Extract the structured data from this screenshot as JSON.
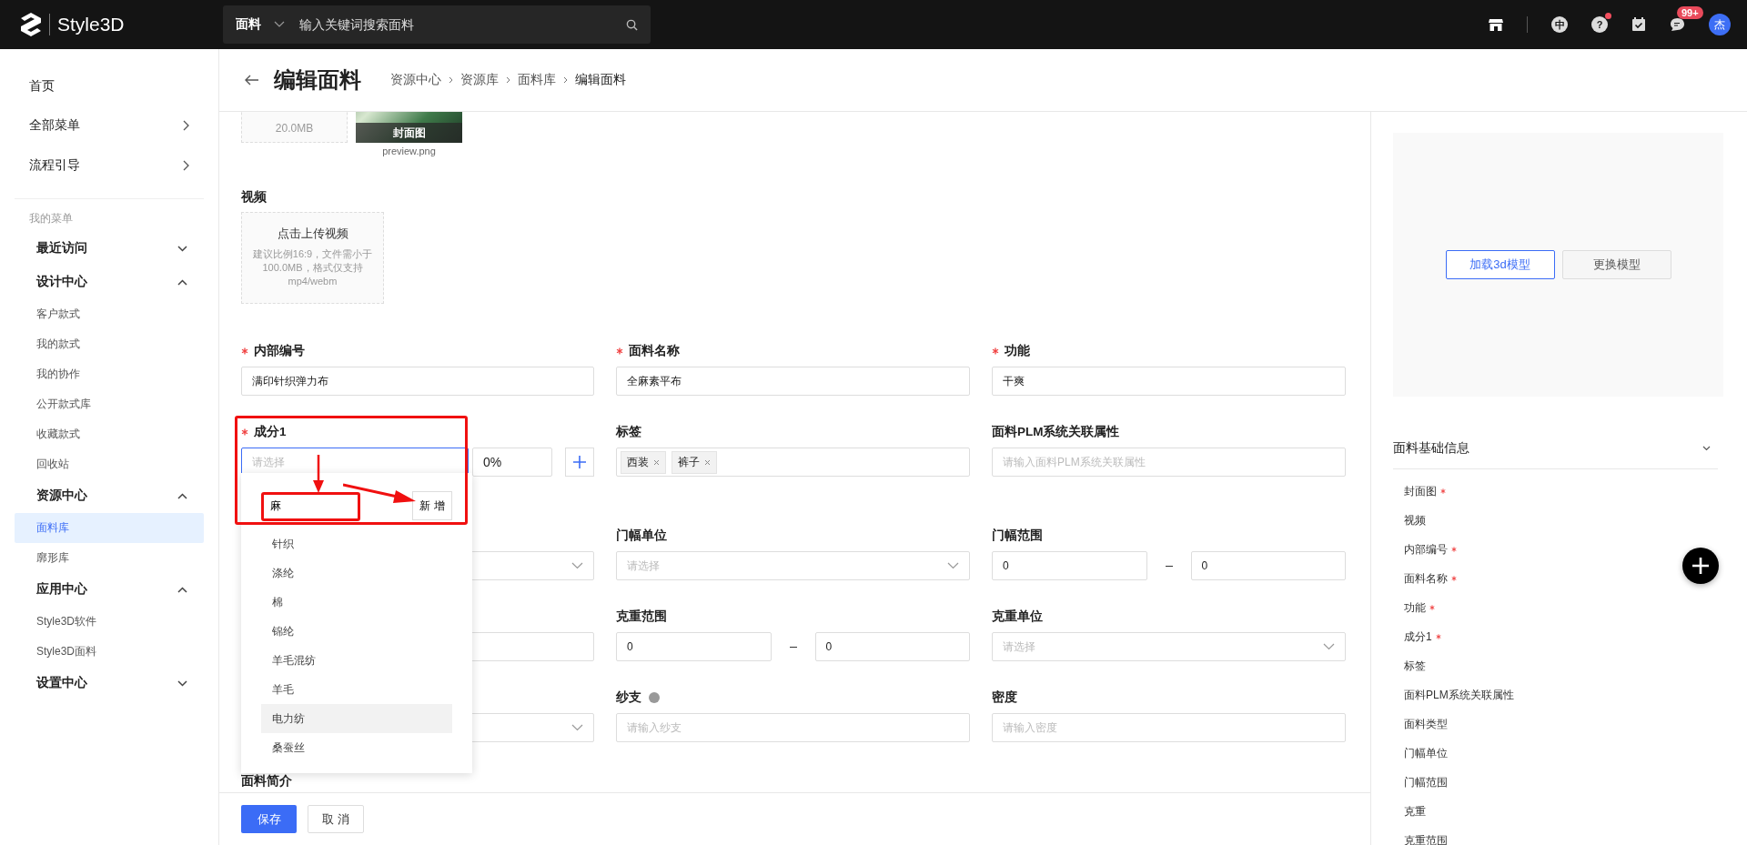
{
  "header": {
    "logo": "Style3D",
    "search": {
      "category": "面料",
      "placeholder": "输入关键词搜索面料"
    },
    "language": "中",
    "help": "?",
    "help_dot": true,
    "message_badge": "99+",
    "avatar": "杰"
  },
  "sidebar": {
    "top_items": [
      {
        "label": "首页",
        "has_arrow": false
      },
      {
        "label": "全部菜单",
        "has_arrow": true
      },
      {
        "label": "流程引导",
        "has_arrow": true
      }
    ],
    "section_title": "我的菜单",
    "groups": [
      {
        "label": "最近访问",
        "expanded": false
      },
      {
        "label": "设计中心",
        "expanded": true,
        "children": [
          {
            "label": "客户款式",
            "selected": false
          },
          {
            "label": "我的款式",
            "selected": false
          },
          {
            "label": "我的协作",
            "selected": false
          },
          {
            "label": "公开款式库",
            "selected": false
          },
          {
            "label": "收藏款式",
            "selected": false
          },
          {
            "label": "回收站",
            "selected": false
          }
        ]
      },
      {
        "label": "资源中心",
        "expanded": true,
        "children": [
          {
            "label": "面料库",
            "selected": true
          },
          {
            "label": "廓形库",
            "selected": false
          }
        ]
      },
      {
        "label": "应用中心",
        "expanded": true,
        "children": [
          {
            "label": "Style3D软件",
            "selected": false
          },
          {
            "label": "Style3D面料",
            "selected": false
          }
        ]
      },
      {
        "label": "设置中心",
        "expanded": false
      }
    ]
  },
  "page": {
    "title": "编辑面料",
    "breadcrumb": [
      "资源中心",
      "资源库",
      "面料库",
      "编辑面料"
    ]
  },
  "uploads": {
    "cover_hint": "20.0MB",
    "cover_overlay": "封面图",
    "cover_filename": "preview.png",
    "video_label": "视频",
    "video_title": "点击上传视频",
    "video_hint": "建议比例16:9，文件需小于100.0MB，格式仅支持mp4/webm"
  },
  "rows": [
    [
      {
        "kind": "input",
        "label": "内部编号",
        "required": true,
        "value": "满印针织弹力布"
      },
      {
        "kind": "input",
        "label": "面料名称",
        "required": true,
        "value": "全麻素平布"
      },
      {
        "kind": "input",
        "label": "功能",
        "required": true,
        "value": "干爽"
      }
    ],
    [
      {
        "kind": "composition",
        "label": "成分1",
        "required": true,
        "placeholder": "请选择",
        "percent": "0%",
        "focused": true
      },
      {
        "kind": "tags",
        "label": "标签",
        "required": false,
        "tags": [
          "西装",
          "裤子"
        ]
      },
      {
        "kind": "input",
        "label": "面料PLM系统关联属性",
        "required": false,
        "placeholder": "请输入面料PLM系统关联属性"
      }
    ],
    [
      {
        "kind": "select"
      },
      {
        "kind": "select",
        "label": "门幅单位",
        "required": false,
        "placeholder": "请选择"
      },
      {
        "kind": "range",
        "label": "门幅范围",
        "required": false,
        "from": "0",
        "to": "0"
      }
    ],
    [
      {
        "kind": "input"
      },
      {
        "kind": "range",
        "label": "克重范围",
        "required": false,
        "from": "0",
        "to": "0"
      },
      {
        "kind": "select",
        "label": "克重单位",
        "required": false,
        "placeholder": "请选择"
      }
    ],
    [
      {
        "kind": "select"
      },
      {
        "kind": "input",
        "label": "纱支",
        "required": false,
        "info": true,
        "placeholder": "请输入纱支"
      },
      {
        "kind": "input",
        "label": "密度",
        "required": false,
        "placeholder": "请输入密度"
      }
    ]
  ],
  "intro_label": "面料简介",
  "dropdown": {
    "search_value": "麻",
    "add_button": "新 增",
    "options": [
      {
        "label": "针织",
        "highlighted": false
      },
      {
        "label": "涤纶",
        "highlighted": false
      },
      {
        "label": "棉",
        "highlighted": false
      },
      {
        "label": "锦纶",
        "highlighted": false
      },
      {
        "label": "羊毛混纺",
        "highlighted": false
      },
      {
        "label": "羊毛",
        "highlighted": false
      },
      {
        "label": "电力纺",
        "highlighted": true
      },
      {
        "label": "桑蚕丝",
        "highlighted": false
      }
    ]
  },
  "footer": {
    "save": "保存",
    "cancel": "取 消"
  },
  "right_panel": {
    "load_button": "加载3d模型",
    "replace_button": "更换模型",
    "section_title": "面料基础信息",
    "anchors": [
      {
        "label": "封面图",
        "required": true
      },
      {
        "label": "视频",
        "required": false
      },
      {
        "label": "内部编号",
        "required": true
      },
      {
        "label": "面料名称",
        "required": true
      },
      {
        "label": "功能",
        "required": true
      },
      {
        "label": "成分1",
        "required": true
      },
      {
        "label": "标签",
        "required": false
      },
      {
        "label": "面料PLM系统关联属性",
        "required": false
      },
      {
        "label": "面料类型",
        "required": false
      },
      {
        "label": "门幅单位",
        "required": false
      },
      {
        "label": "门幅范围",
        "required": false
      },
      {
        "label": "克重",
        "required": false
      },
      {
        "label": "克重范围",
        "required": false
      }
    ]
  }
}
